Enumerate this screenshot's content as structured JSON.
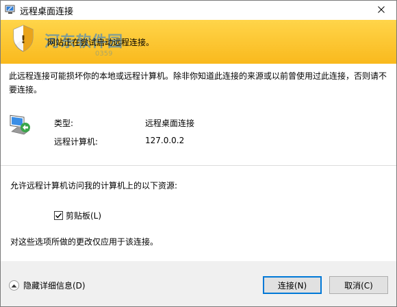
{
  "window": {
    "title": "远程桌面连接"
  },
  "banner": {
    "message": "网站正在尝试启动远程连接。",
    "watermark": "河东软件园",
    "watermark_sub": "0359"
  },
  "warning": {
    "text": "此远程连接可能损坏你的本地或远程计算机。除非你知道此连接的来源或以前曾使用过此连接，否则请不要连接。"
  },
  "connection": {
    "type_label": "类型:",
    "type_value": "远程桌面连接",
    "computer_label": "远程计算机:",
    "computer_value": "127.0.0.2"
  },
  "resources": {
    "prompt": "允许远程计算机访问我的计算机上的以下资源:",
    "clipboard_label": "剪贴板(L)",
    "clipboard_checked": true,
    "note": "对这些选项所做的更改仅应用于该连接。"
  },
  "footer": {
    "details_label": "隐藏详细信息(D)",
    "connect_label": "连接(N)",
    "cancel_label": "取消(C)"
  },
  "colors": {
    "banner_top": "#ffd54a",
    "banner_bottom": "#f9b91d",
    "accent": "#0078d7",
    "footer_bg": "#f0f0f0"
  }
}
